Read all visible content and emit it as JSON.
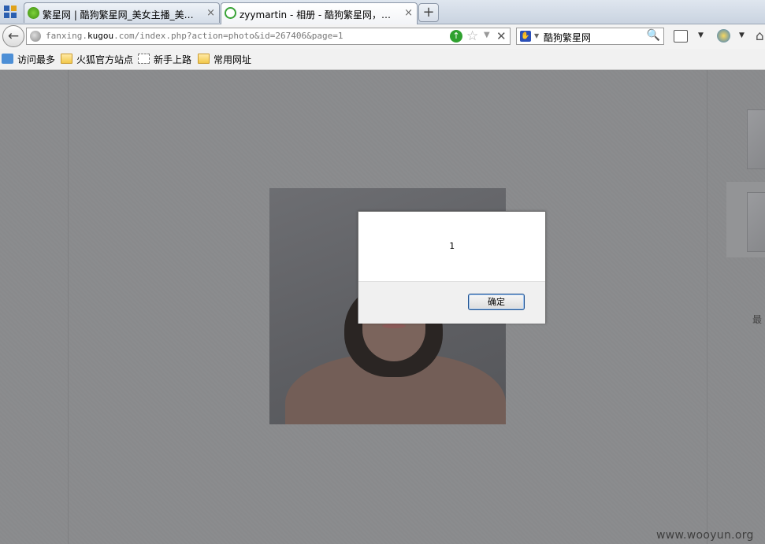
{
  "browser": {
    "tabs": [
      {
        "title": "繁星网 | 酷狗繁星网_美女主播_美…",
        "close": "×"
      },
      {
        "title": "zyymartin - 相册 - 酷狗繁星网，…",
        "close": "×"
      }
    ],
    "new_tab_label": "+",
    "address": {
      "prefix": "fanxing.",
      "domain": "kugou",
      "rest": ".com/index.php?action=photo&id=267406&page=1"
    },
    "search": {
      "value": "酷狗繁星网"
    },
    "bookmarks": [
      "访问最多",
      "火狐官方站点",
      "新手上路",
      "常用网址"
    ],
    "icons": {
      "back": "←",
      "go": "↑",
      "star": "☆",
      "dropdown": "▼",
      "stop": "✕",
      "search": "🔍",
      "home": "⌂",
      "caret": "▼"
    }
  },
  "page": {
    "side_text": "最"
  },
  "dialog": {
    "message": "1",
    "ok_label": "确定"
  },
  "watermark": "www.wooyun.org",
  "colors": {
    "overlay": "#8a8b8d",
    "dialog_footer": "#f0f0f0",
    "button_border": "#1e4f8c",
    "go_green": "#2fa12f"
  }
}
